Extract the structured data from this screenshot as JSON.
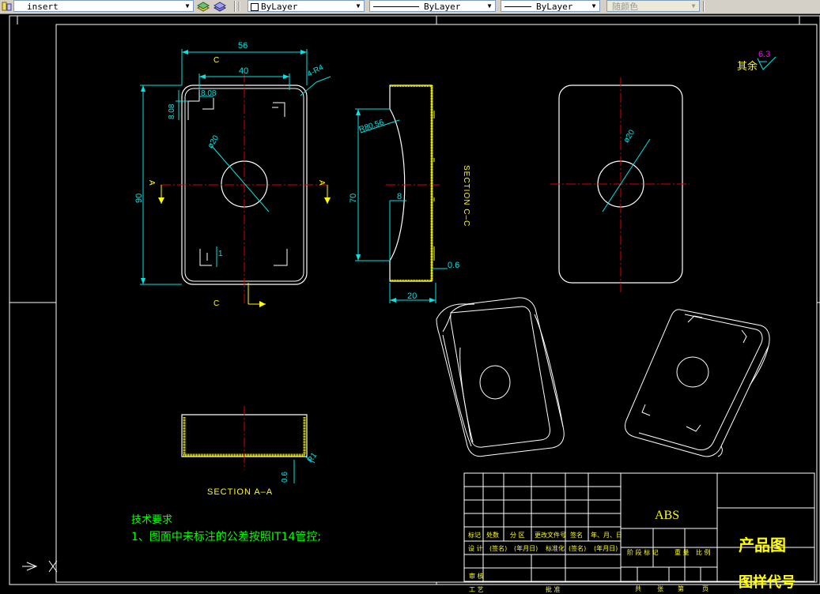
{
  "toolbar": {
    "layer_name": "insert",
    "color_value": "ByLayer",
    "linetype_value": "ByLayer",
    "lineweight_value": "ByLayer",
    "plotstyle_value": "随颜色"
  },
  "drawing": {
    "dims": {
      "width_56": "56",
      "width_40": "40",
      "radius_4": "4-R4",
      "d_808_h": "8.08",
      "d_808_v": "8.08",
      "height_90": "90",
      "dia_20_front": "ø20",
      "d_1": "1",
      "r80": "R80.56",
      "height_70": "70",
      "d_8": "8",
      "d_06_side": "0.6",
      "width_20": "20",
      "dia_20_right": "ø20",
      "d_06_sec": "0.6",
      "r1": "R1"
    },
    "labels": {
      "view_a_left": "A",
      "view_a_right": "A",
      "view_c_top": "C",
      "view_c_bottom": "C",
      "section_cc": "SECTION C–C",
      "section_aa": "SECTION A–A"
    },
    "roughness": {
      "label": "其余",
      "value": "6.3"
    },
    "tech_notes": {
      "heading": "技术要求",
      "line1": "1、图面中未标注的公差按照IT14管控;"
    },
    "title_block": {
      "material": "ABS",
      "product_title": "产品图",
      "drawing_code": "图样代号",
      "row_headers": [
        "标记",
        "处数",
        "分 区",
        "更改文件号",
        "签名",
        "年、月、日"
      ],
      "design_row": [
        "设 计",
        "(签名)",
        "(年月日)",
        "标准化",
        "(签名)",
        "(年月日)"
      ],
      "stage_headers": [
        "阶 段 标 记",
        "重 量",
        "比 例"
      ],
      "review": "审 核",
      "process": "工 艺",
      "approve": "批 准",
      "sheets": [
        "共",
        "张",
        "第",
        "页"
      ]
    }
  },
  "colors": {
    "background": "#000000",
    "outline": "#ffffff",
    "dimension": "#00e5e5",
    "centerline": "#e00000",
    "text_yellow": "#ffff00",
    "text_green": "#00ff00",
    "roughness_magenta": "#ff00ff",
    "toolbar_bg": "#d4d0c8"
  }
}
